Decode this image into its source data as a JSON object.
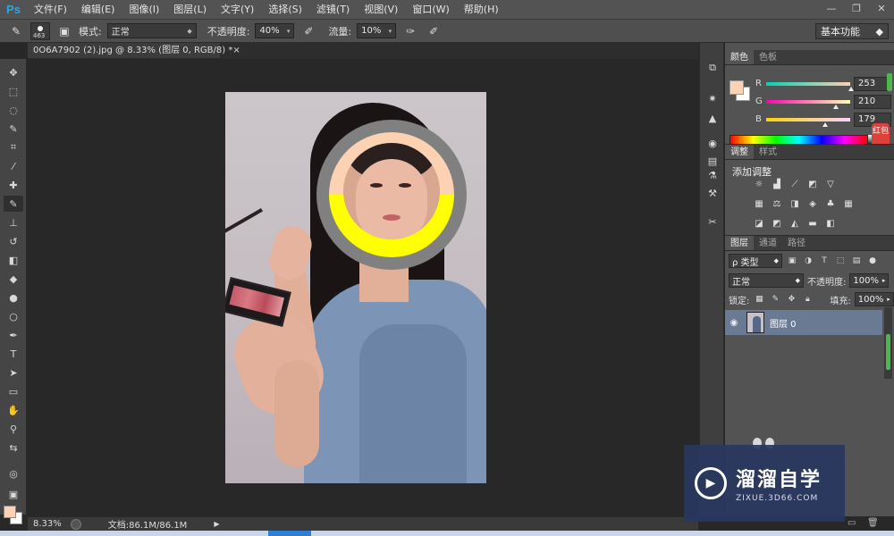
{
  "app": {
    "logo": "Ps"
  },
  "menu": [
    "文件(F)",
    "编辑(E)",
    "图像(I)",
    "图层(L)",
    "文字(Y)",
    "选择(S)",
    "滤镜(T)",
    "视图(V)",
    "窗口(W)",
    "帮助(H)"
  ],
  "window_controls": {
    "minimize": "—",
    "restore": "❐",
    "close": "✕"
  },
  "options": {
    "brush_size": "463",
    "mode_label": "模式:",
    "mode_value": "正常",
    "opacity_label": "不透明度:",
    "opacity_value": "40%",
    "flow_label": "流量:",
    "flow_value": "10%",
    "workspace": "基本功能"
  },
  "document": {
    "tab_title": "0O6A7902 (2).jpg @ 8.33% (图层 0, RGB/8) *",
    "tab_close": "×"
  },
  "status": {
    "zoom": "8.33%",
    "doc_info": "文档:86.1M/86.1M",
    "arrow": "▶"
  },
  "color_panel": {
    "tabs": [
      "颜色",
      "色板"
    ],
    "channels": [
      {
        "name": "R",
        "value": "253"
      },
      {
        "name": "G",
        "value": "210"
      },
      {
        "name": "B",
        "value": "179"
      }
    ],
    "red_badge": "红包",
    "fg_color": "#fdd2b3",
    "bg_color": "#ffffff"
  },
  "adjustments_panel": {
    "tabs": [
      "调整",
      "样式"
    ],
    "title": "添加调整"
  },
  "layers_panel": {
    "tabs": [
      "图层",
      "通道",
      "路径"
    ],
    "filter_label": "ρ 类型",
    "blend_mode": "正常",
    "opacity_label": "不透明度:",
    "opacity_value": "100%",
    "lock_label": "锁定:",
    "fill_label": "填充:",
    "fill_value": "100%",
    "layers": [
      {
        "name": "图层 0",
        "visible": true
      }
    ]
  },
  "loupe": {
    "top_color": "#fdd2b3",
    "bottom_color": "#ffff00",
    "ring_color": "#808080"
  },
  "watermark": {
    "title": "溜溜自学",
    "url": "ZIXUE.3D66.COM"
  }
}
